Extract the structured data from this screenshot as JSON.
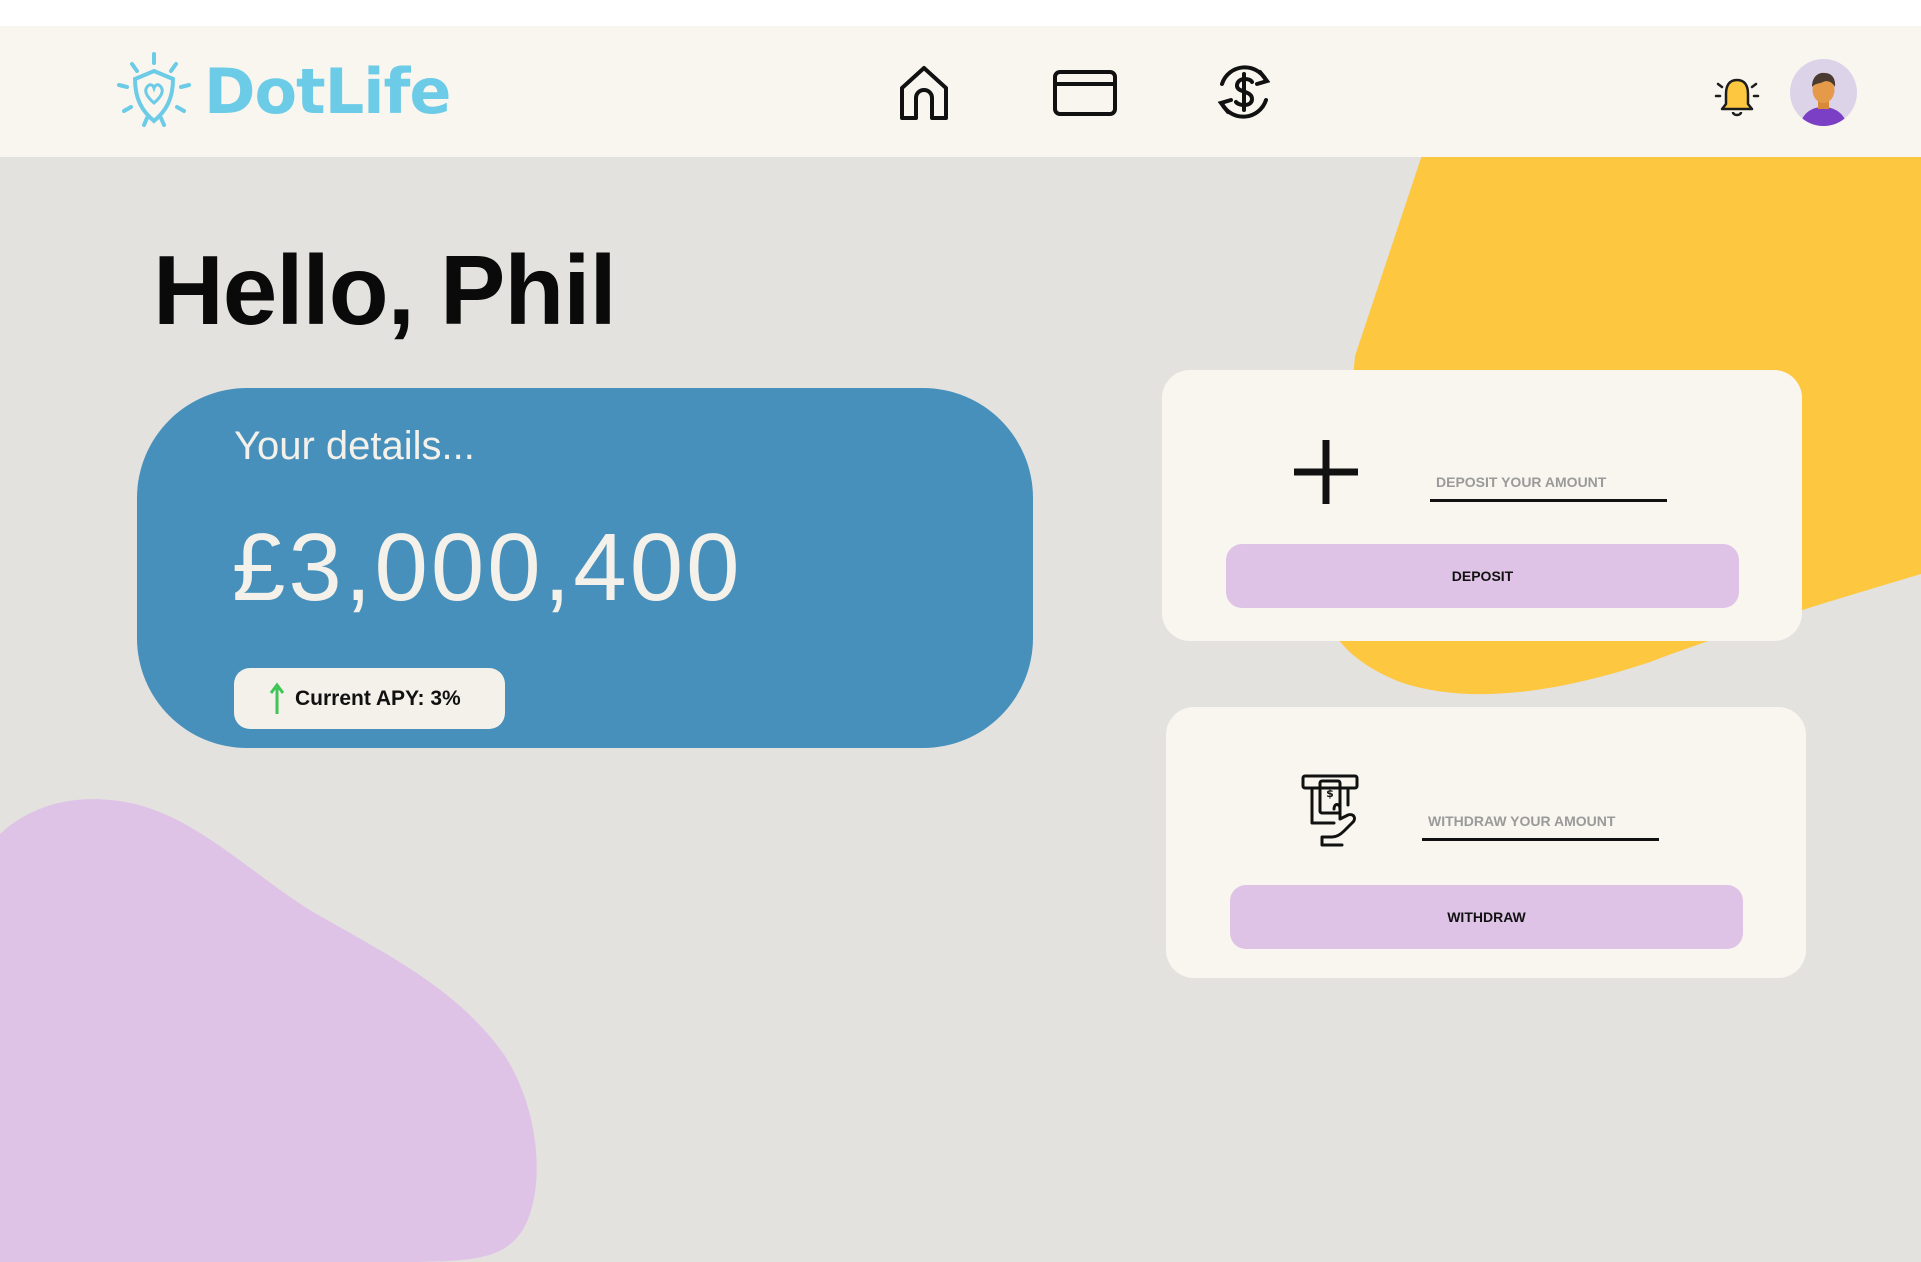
{
  "brand": {
    "name": "DotLife",
    "logo_icon": "shield-sun-icon"
  },
  "nav": [
    {
      "icon": "home-icon"
    },
    {
      "icon": "credit-card-icon"
    },
    {
      "icon": "dollar-exchange-icon"
    }
  ],
  "header": {
    "bell_icon": "bell-icon",
    "avatar_icon": "user-avatar"
  },
  "greeting": "Hello, Phil",
  "account": {
    "details_label": "Your details...",
    "balance": "£3,000,400",
    "apy_label": "Current APY: 3%",
    "apy_icon": "arrow-up-icon"
  },
  "deposit": {
    "icon": "plus-icon",
    "placeholder": "DEPOSIT YOUR AMOUNT",
    "value": "",
    "button_label": "DEPOSIT"
  },
  "withdraw": {
    "icon": "atm-withdraw-icon",
    "placeholder": "WITHDRAW YOUR AMOUNT",
    "value": "",
    "button_label": "WITHDRAW"
  },
  "colors": {
    "background": "#e3e2df",
    "header": "#f8f6ef",
    "brand": "#6ccbe6",
    "card_blue": "#4890bc",
    "accent_yellow": "#fdc73f",
    "accent_purple": "#dec3e6",
    "apy_arrow": "#3fc556"
  }
}
